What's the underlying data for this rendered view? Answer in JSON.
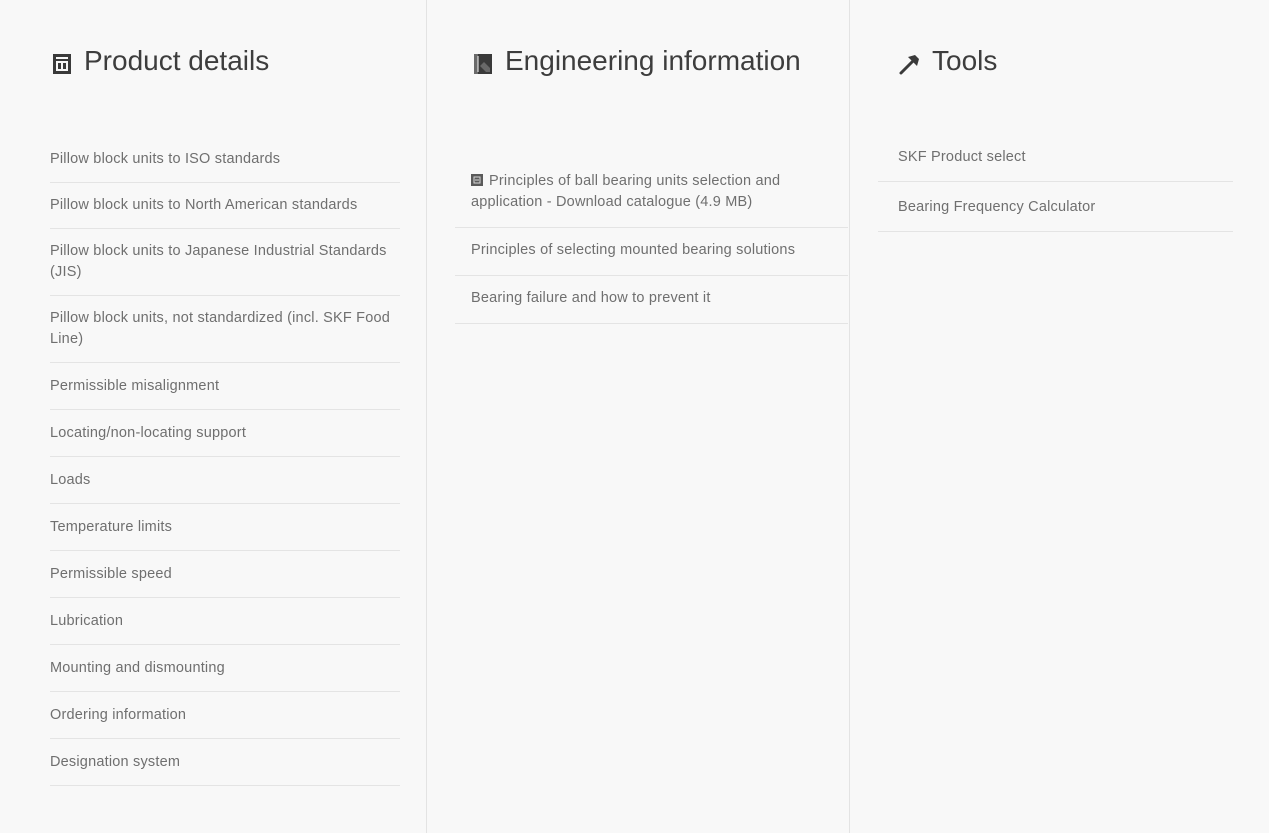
{
  "columns": [
    {
      "title": "Product details",
      "icon": "product-sheet-icon",
      "items": [
        "Pillow block units to ISO standards",
        "Pillow block units to North American standards",
        "Pillow block units to Japanese Industrial Standards (JIS)",
        "Pillow block units, not standardized (incl. SKF Food Line)",
        "Permissible misalignment",
        "Locating/non-locating support",
        "Loads",
        "Temperature limits",
        "Permissible speed",
        "Lubrication",
        "Mounting and dismounting",
        "Ordering information",
        "Designation system"
      ]
    },
    {
      "title": "Engineering information",
      "icon": "engineering-book-icon",
      "items": [
        "Principles of ball bearing units selection and application - Download catalogue (4.9 MB)",
        "Principles of selecting mounted bearing solutions",
        "Bearing failure and how to prevent it"
      ]
    },
    {
      "title": "Tools",
      "icon": "tools-hammer-icon",
      "items": [
        "SKF Product select",
        "Bearing Frequency Calculator"
      ]
    }
  ],
  "colors": {
    "background": "#f8f8f8",
    "heading": "#3d3d3d",
    "link_text": "#6f6f6f",
    "divider": "#e4e4e4"
  }
}
